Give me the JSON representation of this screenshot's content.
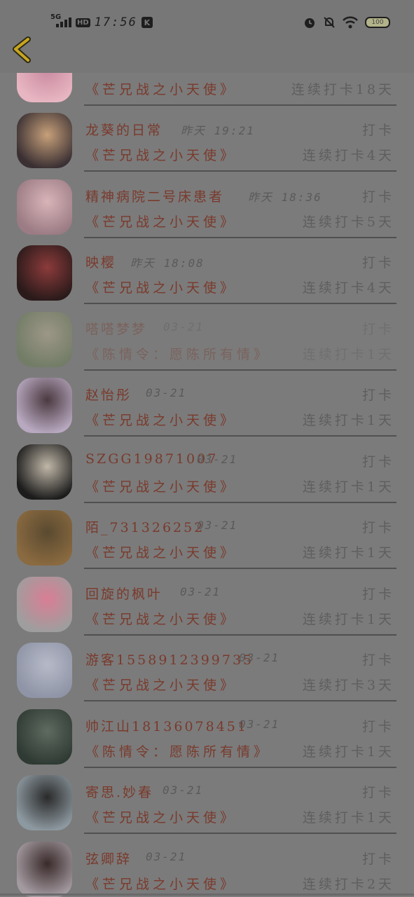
{
  "status_bar": {
    "network": "5G",
    "hd": "HD",
    "time": "17:56",
    "app_badge": "K",
    "battery": "100"
  },
  "nav": {
    "back_icon": "chevron-left-icon",
    "accent": "#c9a51f"
  },
  "rows": [
    {
      "name": "",
      "time": "",
      "action": "",
      "title": "《芒兄战之小天使》",
      "streak": "连续打卡18天",
      "avatar_colors": [
        "#e8b6c2",
        "#c98aa0"
      ]
    },
    {
      "name": "龙葵的日常",
      "time": "昨天 19:21",
      "action": "打卡",
      "title": "《芒兄战之小天使》",
      "streak": "连续打卡4天",
      "avatar_colors": [
        "#3a3033",
        "#c7a07a"
      ]
    },
    {
      "name": "精神病院二号床患者",
      "time": "昨天 18:36",
      "action": "打卡",
      "title": "《芒兄战之小天使》",
      "streak": "连续打卡5天",
      "avatar_colors": [
        "#9b7b84",
        "#d8b4b8"
      ]
    },
    {
      "name": "映樱",
      "time": "昨天 18:08",
      "action": "打卡",
      "title": "《芒兄战之小天使》",
      "streak": "连续打卡4天",
      "avatar_colors": [
        "#2a1a1a",
        "#8c3b3b"
      ]
    },
    {
      "name": "嗒嗒梦梦",
      "time": "03-21",
      "action": "打卡",
      "title": "《陈情令：愿陈所有情》",
      "streak": "连续打卡1天",
      "avatar_colors": [
        "#6f7d60",
        "#a8a08a"
      ],
      "faded": true
    },
    {
      "name": "赵怡彤",
      "time": "03-21",
      "action": "打卡",
      "title": "《芒兄战之小天使》",
      "streak": "连续打卡1天",
      "avatar_colors": [
        "#b8a8c0",
        "#4b3a40"
      ]
    },
    {
      "name": "SZGG19871007",
      "time": "03-21",
      "action": "打卡",
      "title": "《芒兄战之小天使》",
      "streak": "连续打卡1天",
      "avatar_colors": [
        "#1c1c1c",
        "#c0b7a8"
      ]
    },
    {
      "name": "陌_731326252",
      "time": "03-21",
      "action": "打卡",
      "title": "《芒兄战之小天使》",
      "streak": "连续打卡1天",
      "avatar_colors": [
        "#8a6a40",
        "#5a4a30"
      ]
    },
    {
      "name": "回旋的枫叶",
      "time": "03-21",
      "action": "打卡",
      "title": "《芒兄战之小天使》",
      "streak": "连续打卡1天",
      "avatar_colors": [
        "#9e9e9e",
        "#d97e94"
      ]
    },
    {
      "name": "游客1558912399735",
      "time": "03-21",
      "action": "打卡",
      "title": "《芒兄战之小天使》",
      "streak": "连续打卡3天",
      "avatar_colors": [
        "#8f94a6",
        "#b6bac8"
      ]
    },
    {
      "name": "帅江山18136078451",
      "time": "03-21",
      "action": "打卡",
      "title": "《陈情令：愿陈所有情》",
      "streak": "连续打卡1天",
      "avatar_colors": [
        "#2e3a33",
        "#5f6b60"
      ]
    },
    {
      "name": "寄思.妙春",
      "time": "03-21",
      "action": "打卡",
      "title": "《芒兄战之小天使》",
      "streak": "连续打卡1天",
      "avatar_colors": [
        "#8d99a0",
        "#2a2a2a"
      ]
    },
    {
      "name": "弦卿辞",
      "time": "03-21",
      "action": "打卡",
      "title": "《芒兄战之小天使》",
      "streak": "连续打卡2天",
      "avatar_colors": [
        "#a39aa0",
        "#3a2a2a"
      ]
    }
  ]
}
